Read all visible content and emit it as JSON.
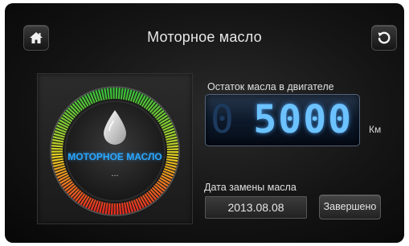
{
  "header": {
    "title": "Моторное масло",
    "home_icon": "home-icon",
    "back_icon": "back-refresh-icon"
  },
  "gauge": {
    "label": "МОТОРНОЕ МАСЛО",
    "sub_value": "...",
    "icon": "oil-drop-icon",
    "colors": {
      "green": "#3cc03a",
      "yellow": "#e8d020",
      "red": "#e83020",
      "label": "#2aa8ff"
    }
  },
  "remaining": {
    "label": "Остаток масла в двигателе",
    "ghost_digit": "0",
    "value": "5000",
    "unit": "Км"
  },
  "change_date": {
    "label": "Дата замены масла",
    "value": "2013.08.08"
  },
  "actions": {
    "done_label": "Завершено"
  }
}
